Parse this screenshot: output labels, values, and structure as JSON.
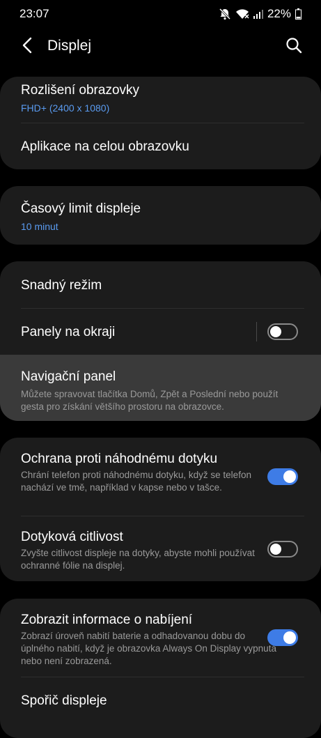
{
  "status": {
    "time": "23:07",
    "battery": "22%",
    "icons": [
      "mute-icon",
      "wifi-icon",
      "signal-icon",
      "battery-icon"
    ]
  },
  "header": {
    "title": "Displej",
    "back_icon": "back-arrow-icon",
    "search_icon": "search-icon"
  },
  "sections": {
    "resolution": {
      "title": "Rozlišení obrazovky",
      "value": "FHD+ (2400 x 1080)"
    },
    "fullscreen_apps": {
      "title": "Aplikace na celou obrazovku"
    },
    "timeout": {
      "title": "Časový limit displeje",
      "value": "10 minut"
    },
    "easy_mode": {
      "title": "Snadný režim"
    },
    "edge_panels": {
      "title": "Panely na okraji",
      "enabled": false
    },
    "nav_bar": {
      "title": "Navigační panel",
      "desc": "Můžete spravovat tlačítka Domů, Zpět a Poslední nebo použít gesta pro získání většího prostoru na obrazovce."
    },
    "accidental_touch": {
      "title": "Ochrana proti náhodnému dotyku",
      "desc": "Chrání telefon proti náhodnému dotyku, když se telefon nachází ve tmě, například v kapse nebo v tašce.",
      "enabled": true
    },
    "touch_sensitivity": {
      "title": "Dotyková citlivost",
      "desc": "Zvyšte citlivost displeje na dotyky, abyste mohli používat ochranné fólie na displej.",
      "enabled": false
    },
    "charging_info": {
      "title": "Zobrazit informace o nabíjení",
      "desc": "Zobrazí úroveň nabití baterie a odhadovanou dobu do úplného nabití, když je obrazovka Always On Display vypnutá nebo není zobrazená.",
      "enabled": true
    },
    "screen_saver": {
      "title": "Spořič displeje"
    }
  },
  "colors": {
    "accent": "#3e7ce6",
    "value_text": "#5a9bf0",
    "card": "#1c1c1c",
    "highlight": "#3a3a3a"
  }
}
